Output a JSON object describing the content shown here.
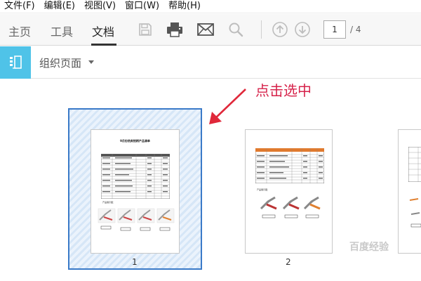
{
  "menu": [
    "文件(F)",
    "编辑(E)",
    "视图(V)",
    "窗口(W)",
    "帮助(H)"
  ],
  "toolbar": {
    "tabs": [
      {
        "label": "主页",
        "active": false
      },
      {
        "label": "工具",
        "active": false
      },
      {
        "label": "文档",
        "active": true
      }
    ],
    "icons": [
      "save-icon",
      "print-icon",
      "mail-icon",
      "search-icon",
      "page-up-icon",
      "page-down-icon"
    ],
    "page_current": "1",
    "page_total": "/ 4"
  },
  "organize": {
    "label": "组织页面",
    "icon": "organize-pages-icon"
  },
  "annotation": {
    "text": "点击选中",
    "color": "#d6224a"
  },
  "pages": [
    {
      "number": "1",
      "selected": true,
      "title": "9月份热卖钳柄产品清单",
      "caption": "产品展示图："
    },
    {
      "number": "2",
      "selected": false,
      "caption": "产品展示图："
    },
    {
      "number": "",
      "selected": false
    }
  ],
  "watermark": "百度经验",
  "colors": {
    "accent": "#4fc3e8",
    "selection": "#3a7ac8",
    "annotation": "#d6224a",
    "table_header": "#e07a2e"
  }
}
